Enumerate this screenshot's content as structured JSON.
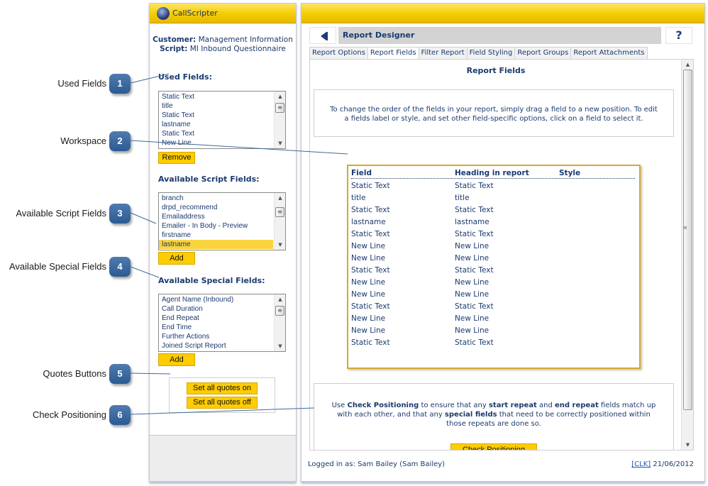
{
  "callouts": [
    {
      "number": "1",
      "label": "Used Fields"
    },
    {
      "number": "2",
      "label": "Workspace"
    },
    {
      "number": "3",
      "label": "Available Script Fields"
    },
    {
      "number": "4",
      "label": "Available Special Fields"
    },
    {
      "number": "5",
      "label": "Quotes Buttons"
    },
    {
      "number": "6",
      "label": "Check Positioning"
    }
  ],
  "app": {
    "brand": "CallScripter",
    "accent_color": "#ffcc00"
  },
  "sidebar": {
    "customer_label": "Customer:",
    "customer_value": "Management Information",
    "script_label": "Script:",
    "script_value": "MI Inbound Questionnaire",
    "used_fields": {
      "title": "Used Fields:",
      "items": [
        "Static Text",
        "title",
        "Static Text",
        "lastname",
        "Static Text",
        "New Line"
      ],
      "button": "Remove"
    },
    "script_fields": {
      "title": "Available Script Fields:",
      "items": [
        "branch",
        "drpd_recommend",
        "Emailaddress",
        "Emailer - In Body - Preview",
        "firstname",
        "lastname"
      ],
      "selected": "lastname",
      "button": "Add"
    },
    "special_fields": {
      "title": "Available Special Fields:",
      "items": [
        "Agent Name (Inbound)",
        "Call Duration",
        "End Repeat",
        "End Time",
        "Further Actions",
        "Joined Script Report"
      ],
      "button": "Add"
    },
    "quotes": {
      "on_button": "Set all quotes on",
      "off_button": "Set all quotes off"
    }
  },
  "main": {
    "title": "Report Designer",
    "help_label": "?",
    "tabs": [
      {
        "label": "Report Options",
        "active": false
      },
      {
        "label": "Report Fields",
        "active": true
      },
      {
        "label": "Filter Report",
        "active": false
      },
      {
        "label": "Field Styling",
        "active": false
      },
      {
        "label": "Report Groups",
        "active": false
      },
      {
        "label": "Report Attachments",
        "active": false
      }
    ],
    "section_title": "Report Fields",
    "info_text": "To change the order of the fields in your report, simply drag a field to a new position. To edit a fields label or style, and set other field-specific options, click on a field to select it.",
    "workspace": {
      "headers": [
        "Field",
        "Heading in report",
        "Style"
      ],
      "rows": [
        {
          "field": "Static Text",
          "heading": "Static Text",
          "style": ""
        },
        {
          "field": "title",
          "heading": "title",
          "style": ""
        },
        {
          "field": "Static Text",
          "heading": "Static Text",
          "style": ""
        },
        {
          "field": "lastname",
          "heading": "lastname",
          "style": ""
        },
        {
          "field": "Static Text",
          "heading": "Static Text",
          "style": ""
        },
        {
          "field": "New Line",
          "heading": "New Line",
          "style": ""
        },
        {
          "field": "New Line",
          "heading": "New Line",
          "style": ""
        },
        {
          "field": "Static Text",
          "heading": "Static Text",
          "style": ""
        },
        {
          "field": "New Line",
          "heading": "New Line",
          "style": ""
        },
        {
          "field": "New Line",
          "heading": "New Line",
          "style": ""
        },
        {
          "field": "Static Text",
          "heading": "Static Text",
          "style": ""
        },
        {
          "field": "New Line",
          "heading": "New Line",
          "style": ""
        },
        {
          "field": "New Line",
          "heading": "New Line",
          "style": ""
        },
        {
          "field": "Static Text",
          "heading": "Static Text",
          "style": ""
        }
      ]
    },
    "check": {
      "text_1": "Use ",
      "bold_1": "Check Positioning",
      "text_2": " to ensure that any ",
      "bold_2": "start repeat",
      "text_3": " and ",
      "bold_3": "end repeat",
      "text_4": " fields match up with each other, and that any ",
      "bold_4": "special fields",
      "text_5": " that need to be correctly positioned within those repeats are done so.",
      "button": "Check Positioning"
    },
    "footer": {
      "logged_in": "Logged in as: Sam Bailey (Sam Bailey)",
      "link": "[CLK]",
      "date": "21/06/2012"
    }
  }
}
